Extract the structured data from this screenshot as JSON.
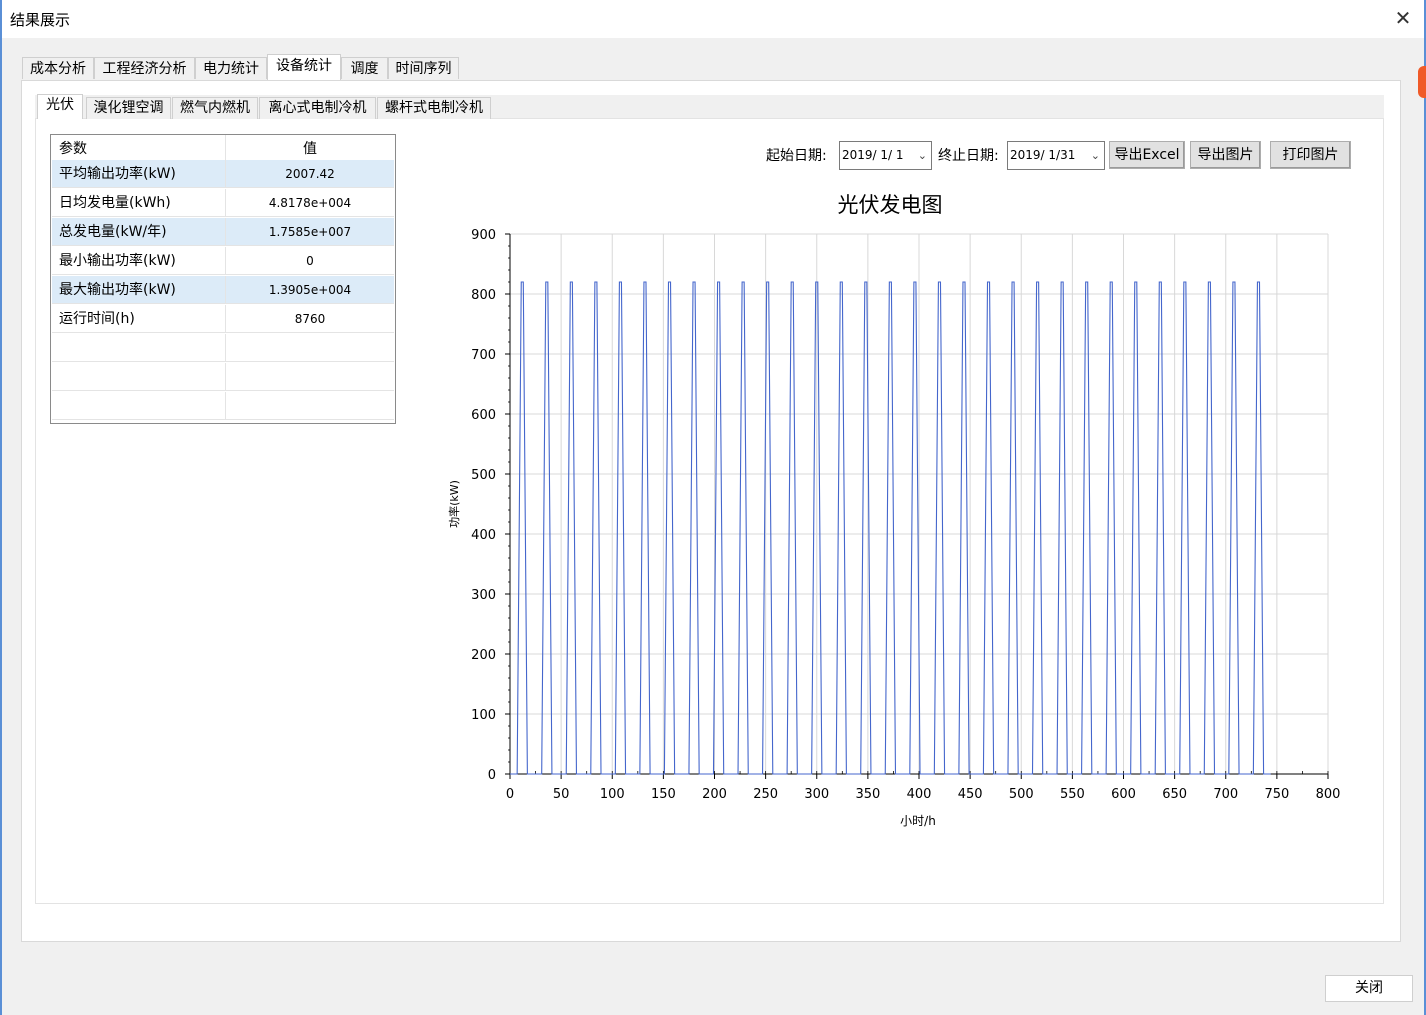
{
  "window": {
    "title": "结果展示",
    "close_glyph": "✕"
  },
  "main_tabs": [
    "成本分析",
    "工程经济分析",
    "电力统计",
    "设备统计",
    "调度",
    "时间序列"
  ],
  "main_tab_active": "设备统计",
  "sub_tabs": [
    "光伏",
    "溴化锂空调",
    "燃气内燃机",
    "离心式电制冷机",
    "螺杆式电制冷机"
  ],
  "sub_tab_active": "光伏",
  "table": {
    "headers": [
      "参数",
      "值"
    ],
    "rows": [
      [
        "平均输出功率(kW)",
        "2007.42"
      ],
      [
        "日均发电量(kWh)",
        "4.8178e+004"
      ],
      [
        "总发电量(kW/年)",
        "1.7585e+007"
      ],
      [
        "最小输出功率(kW)",
        "0"
      ],
      [
        "最大输出功率(kW)",
        "1.3905e+004"
      ],
      [
        "运行时间(h)",
        "8760"
      ]
    ]
  },
  "controls": {
    "start_label": "起始日期:",
    "start_value": "2019/ 1/ 1",
    "end_label": "终止日期:",
    "end_value": "2019/ 1/31",
    "export_excel": "导出Excel",
    "export_image": "导出图片",
    "print_image": "打印图片"
  },
  "footer": {
    "close_label": "关闭"
  },
  "colors": {
    "line": "#4466cc",
    "selected_row": "#dcebf8",
    "grid": "#d8d8d8"
  },
  "chart_data": {
    "type": "line",
    "title": "光伏发电图",
    "xlabel": "小时/h",
    "ylabel": "功率(kW)",
    "xlim": [
      0,
      800
    ],
    "ylim": [
      0,
      900
    ],
    "xticks": [
      0,
      50,
      100,
      150,
      200,
      250,
      300,
      350,
      400,
      450,
      500,
      550,
      600,
      650,
      700,
      750,
      800
    ],
    "yticks": [
      0,
      100,
      200,
      300,
      400,
      500,
      600,
      700,
      800,
      900
    ],
    "grid": true,
    "series": [
      {
        "name": "",
        "pattern": "daily",
        "days": 31,
        "on_hour": 7,
        "off_hour": 17,
        "peak_hours": [
          11,
          13
        ],
        "peak": 820
      }
    ]
  }
}
